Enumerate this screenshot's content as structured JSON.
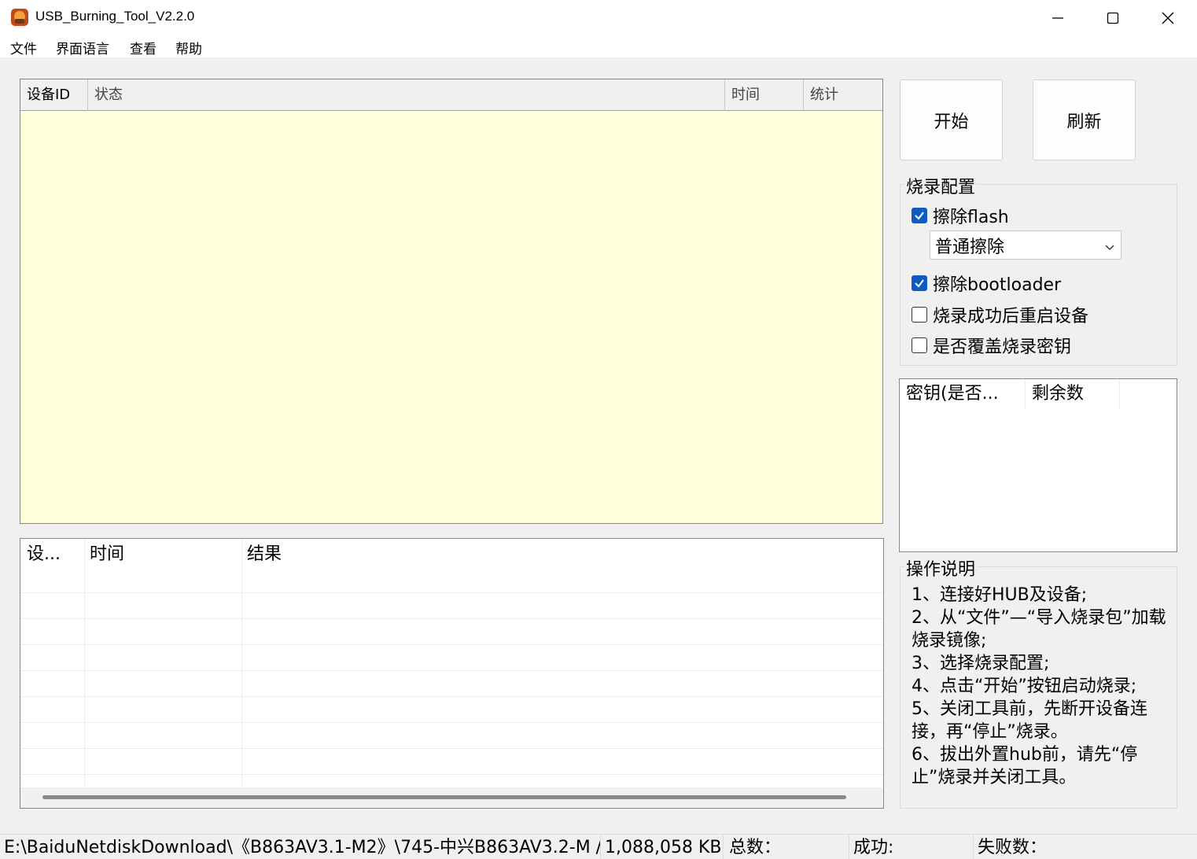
{
  "window": {
    "title": "USB_Burning_Tool_V2.2.0"
  },
  "menu": {
    "items": [
      "文件",
      "界面语言",
      "查看",
      "帮助"
    ]
  },
  "device_table": {
    "columns": [
      "设备ID",
      "状态",
      "时间",
      "统计"
    ],
    "background": "#ffffdc"
  },
  "log_table": {
    "columns": [
      "设...",
      "时间",
      "结果"
    ]
  },
  "buttons": {
    "start": "开始",
    "refresh": "刷新"
  },
  "config": {
    "title": "烧录配置",
    "erase_flash": {
      "label": "擦除flash",
      "checked": true
    },
    "erase_mode": "普通擦除",
    "erase_bootloader": {
      "label": "擦除bootloader",
      "checked": true
    },
    "reboot_after": {
      "label": "烧录成功后重启设备",
      "checked": false
    },
    "overwrite_key": {
      "label": "是否覆盖烧录密钥",
      "checked": false
    }
  },
  "key_table": {
    "columns": [
      "密钥(是否...",
      "剩余数"
    ]
  },
  "help": {
    "title": "操作说明",
    "text": "1、连接好HUB及设备;\n2、从“文件”—“导入烧录包”加载烧录镜像;\n3、选择烧录配置;\n4、点击“开始”按钮启动烧录;\n5、关闭工具前，先断开设备连接，再“停止”烧录。\n6、拔出外置hub前，请先“停止”烧录并关闭工具。"
  },
  "statusbar": {
    "path": "E:\\BaiduNetdiskDownload\\《B863AV3.1-M2》\\745-中兴B863AV3.2-M / ",
    "size": "1,088,058 KB",
    "total": "总数：",
    "success": "成功:",
    "fail": "失败数："
  },
  "colors": {
    "checkbox_accent": "#0f5bc4"
  }
}
